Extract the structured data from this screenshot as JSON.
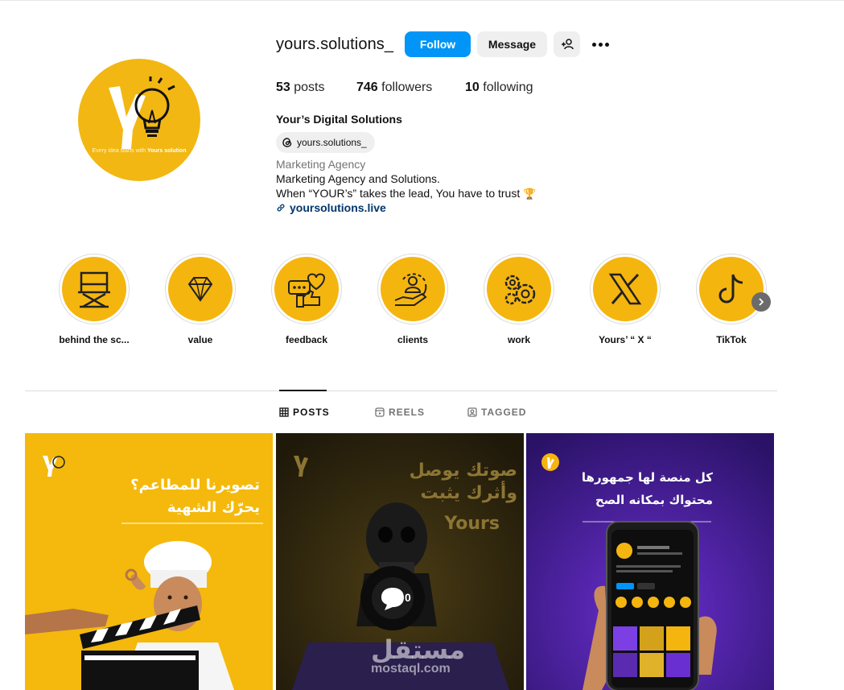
{
  "profile": {
    "username": "yours.solutions_",
    "follow_label": "Follow",
    "message_label": "Message",
    "avatar_tagline_prefix": "Every idea starts with ",
    "avatar_tagline_brand": "Yours solution",
    "posts_count": "53",
    "posts_label": "posts",
    "followers_count": "746",
    "followers_label": "followers",
    "following_count": "10",
    "following_label": "following",
    "full_name": "Your’s Digital Solutions",
    "threads_handle": "yours.solutions_",
    "category": "Marketing Agency",
    "bio_line1": "Marketing Agency and Solutions.",
    "bio_line2": "When “YOUR’s” takes the lead, You have to trust",
    "bio_emoji": "🏆",
    "link": "yoursolutions.live"
  },
  "highlights": [
    {
      "label": "behind the sc...",
      "icon": "directors-chair-icon"
    },
    {
      "label": "value",
      "icon": "diamond-icon"
    },
    {
      "label": "feedback",
      "icon": "feedback-icon"
    },
    {
      "label": "clients",
      "icon": "client-hand-icon"
    },
    {
      "label": "work",
      "icon": "gears-icon"
    },
    {
      "label": "Yours’ “ X “",
      "icon": "x-logo-icon"
    },
    {
      "label": "TikTok",
      "icon": "tiktok-icon"
    }
  ],
  "tabs": [
    {
      "label": "POSTS",
      "active": true
    },
    {
      "label": "REELS",
      "active": false
    },
    {
      "label": "TAGGED",
      "active": false
    }
  ],
  "posts": [
    {
      "line1": "تصويرنا للمطاعم؟",
      "line2": "يحرّك الشهية"
    },
    {
      "line1": "صوتك يوصل",
      "line2": "وأثرك يثبت",
      "line3": "Yours",
      "comments": "0",
      "watermark": "مستقل",
      "watermark_sub": "mostaql.com"
    },
    {
      "line1": "كل منصة لها جمهورها",
      "line2": "محتواك بمكانه الصح"
    }
  ],
  "colors": {
    "brand_yellow": "#f2b712",
    "follow_blue": "#0095f6",
    "link_blue": "#00376b",
    "post3_purple": "#3b1a86"
  }
}
